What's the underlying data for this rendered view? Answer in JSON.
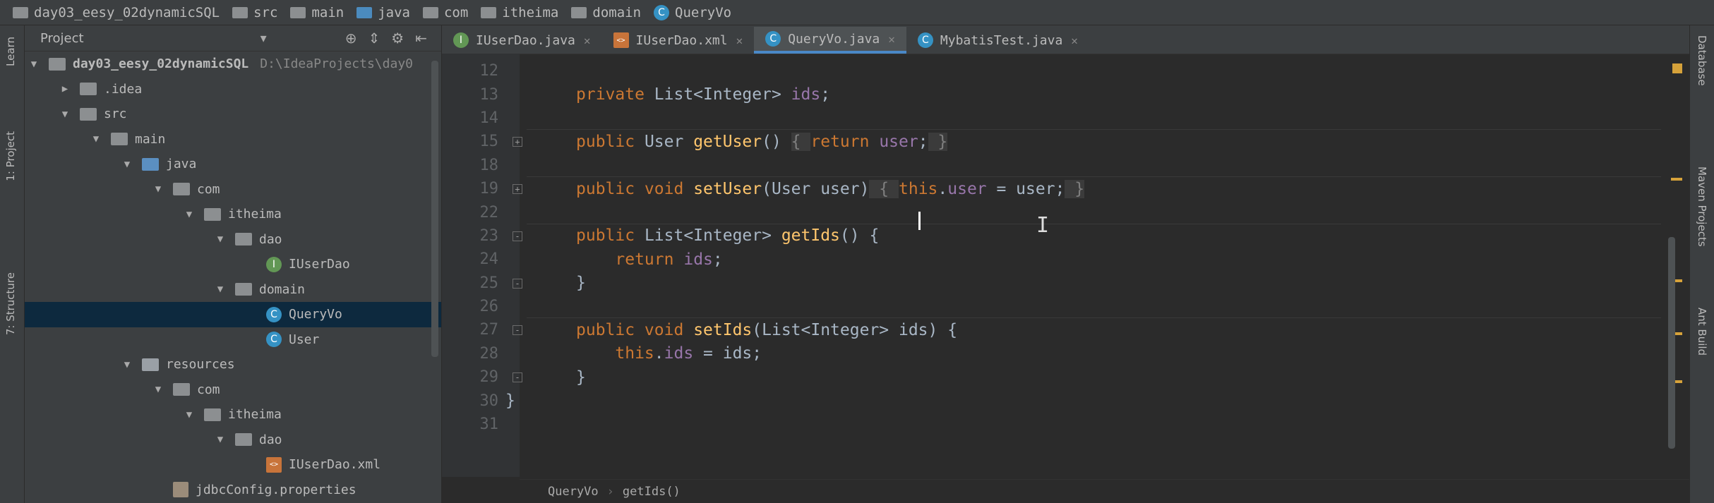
{
  "breadcrumb": [
    "day03_eesy_02dynamicSQL",
    "src",
    "main",
    "java",
    "com",
    "itheima",
    "domain",
    "QueryVo"
  ],
  "left_strip": {
    "learn": "Learn",
    "project": "1: Project",
    "structure": "7: Structure"
  },
  "right_strip": {
    "database": "Database",
    "maven": "Maven Projects",
    "ant": "Ant Build"
  },
  "project": {
    "header_label": "Project",
    "tree": [
      {
        "level": 0,
        "arrow": "▼",
        "icon": "folder",
        "label": "day03_eesy_02dynamicSQL",
        "muted": "D:\\IdeaProjects\\day0"
      },
      {
        "level": 1,
        "arrow": "▶",
        "icon": "folder",
        "label": ".idea"
      },
      {
        "level": 1,
        "arrow": "▼",
        "icon": "folder",
        "label": "src"
      },
      {
        "level": 2,
        "arrow": "▼",
        "icon": "folder",
        "label": "main"
      },
      {
        "level": 3,
        "arrow": "▼",
        "icon": "folder-blue",
        "label": "java"
      },
      {
        "level": 4,
        "arrow": "▼",
        "icon": "folder",
        "label": "com"
      },
      {
        "level": 5,
        "arrow": "▼",
        "icon": "folder",
        "label": "itheima"
      },
      {
        "level": 6,
        "arrow": "▼",
        "icon": "folder",
        "label": "dao"
      },
      {
        "level": 7,
        "arrow": "",
        "icon": "interface",
        "label": "IUserDao"
      },
      {
        "level": 6,
        "arrow": "▼",
        "icon": "folder",
        "label": "domain"
      },
      {
        "level": 7,
        "arrow": "",
        "icon": "class",
        "label": "QueryVo",
        "selected": true
      },
      {
        "level": 7,
        "arrow": "",
        "icon": "class",
        "label": "User"
      },
      {
        "level": 3,
        "arrow": "▼",
        "icon": "folder-res",
        "label": "resources"
      },
      {
        "level": 4,
        "arrow": "▼",
        "icon": "folder",
        "label": "com"
      },
      {
        "level": 5,
        "arrow": "▼",
        "icon": "folder",
        "label": "itheima"
      },
      {
        "level": 6,
        "arrow": "▼",
        "icon": "folder",
        "label": "dao"
      },
      {
        "level": 7,
        "arrow": "",
        "icon": "xml",
        "label": "IUserDao.xml"
      },
      {
        "level": 4,
        "arrow": "",
        "icon": "props",
        "label": "jdbcConfig.properties"
      }
    ]
  },
  "tabs": [
    {
      "label": "IUserDao.java",
      "icon": "interface",
      "active": false
    },
    {
      "label": "IUserDao.xml",
      "icon": "xml",
      "active": false
    },
    {
      "label": "QueryVo.java",
      "icon": "class",
      "active": true
    },
    {
      "label": "MybatisTest.java",
      "icon": "class",
      "active": false
    }
  ],
  "code": [
    {
      "n": "12",
      "html": ""
    },
    {
      "n": "13",
      "html": "<span class='kw'>private</span> List&lt;Integer&gt; <span class='fld'>ids</span>;"
    },
    {
      "n": "14",
      "html": ""
    },
    {
      "n": "15",
      "html": "<span class='kw'>public</span> User <span class='fn'>getUser</span>() <span class='grey'>{ </span><span class='kw'>return</span> <span class='fld'>user</span>;<span class='grey'> }</span>"
    },
    {
      "n": "18",
      "html": ""
    },
    {
      "n": "19",
      "html": "<span class='kw'>public void</span> <span class='fn'>setUser</span>(User user)<span class='grey'> { </span><span class='kw'>this</span>.<span class='fld'>user</span> = user;<span class='grey'> }</span>"
    },
    {
      "n": "22",
      "html": ""
    },
    {
      "n": "23",
      "html": "<span class='kw'>public</span> List&lt;Integer&gt; <span class='fn'>getIds</span>() {"
    },
    {
      "n": "24",
      "html": "    <span class='kw'>return</span> <span class='fld'>ids</span>;"
    },
    {
      "n": "25",
      "html": "}"
    },
    {
      "n": "26",
      "html": ""
    },
    {
      "n": "27",
      "html": "<span class='kw'>public void</span> <span class='fn'>setIds</span>(List&lt;Integer&gt; ids) {"
    },
    {
      "n": "28",
      "html": "    <span class='kw'>this</span>.<span class='fld'>ids</span> = ids;"
    },
    {
      "n": "29",
      "html": "}"
    },
    {
      "n": "30",
      "html": "}"
    },
    {
      "n": "31",
      "html": ""
    }
  ],
  "footer": {
    "class": "QueryVo",
    "method": "getIds()"
  },
  "colors": {
    "keyword": "#cc7832",
    "field": "#9876aa",
    "method": "#ffc66d",
    "text": "#a9b7c6",
    "selection": "#0d293e",
    "accent": "#4a88c7"
  }
}
